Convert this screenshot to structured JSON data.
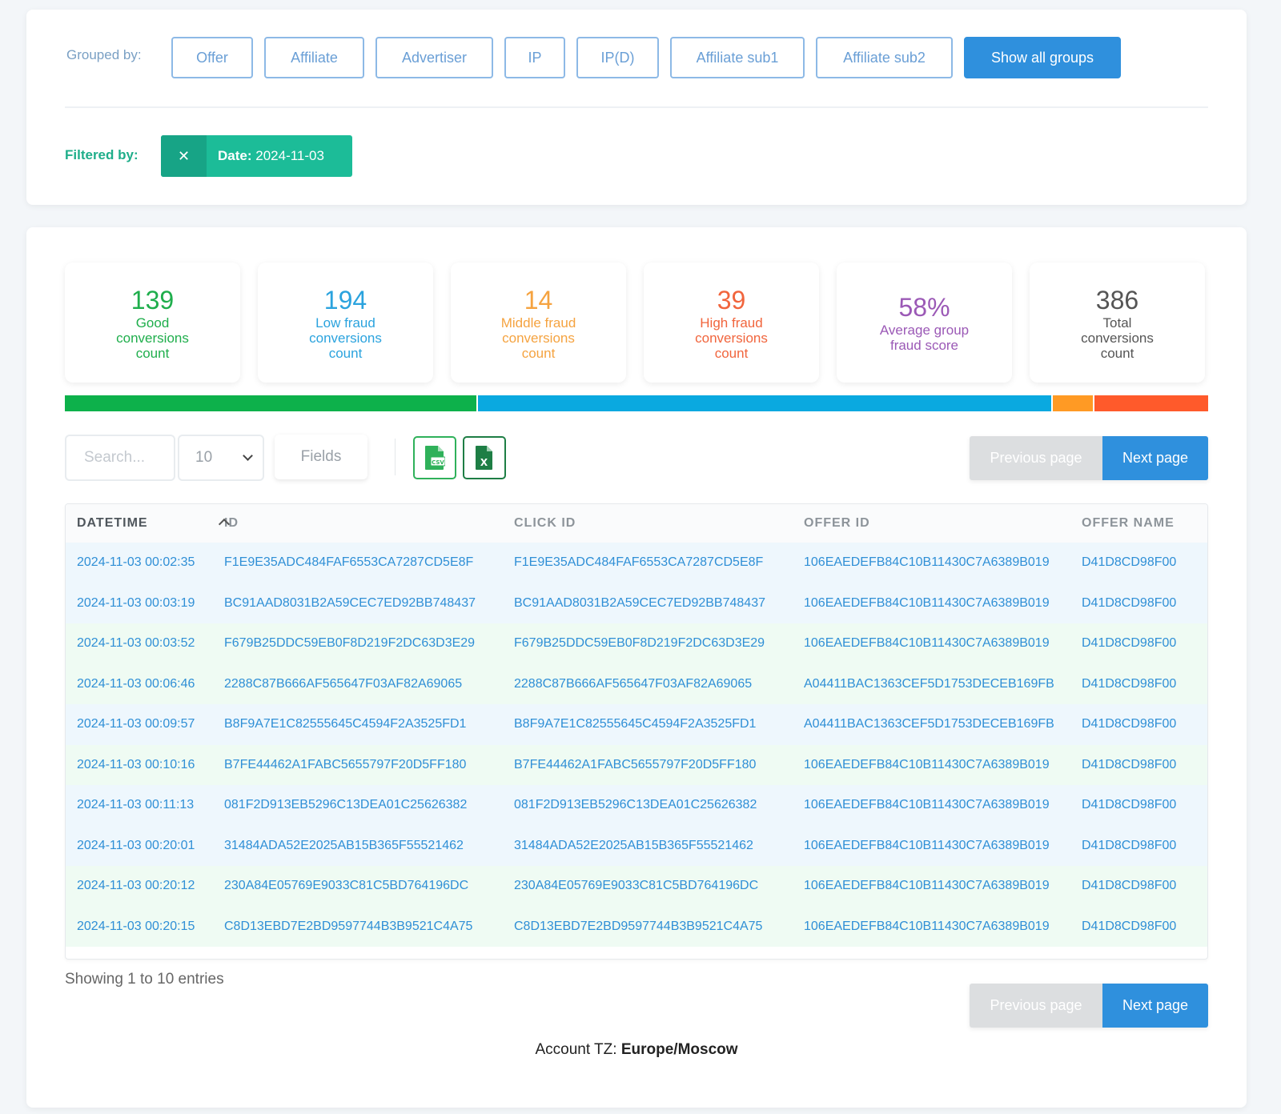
{
  "groups": {
    "label": "Grouped by:",
    "buttons": [
      "Offer",
      "Affiliate",
      "Advertiser",
      "IP",
      "IP(D)",
      "Affiliate sub1",
      "Affiliate sub2"
    ],
    "show_all": "Show all groups"
  },
  "filters": {
    "label": "Filtered by:",
    "chip_key": "Date:",
    "chip_value": "2024-11-03"
  },
  "stats": [
    {
      "value": "139",
      "label": "Good conversions count",
      "color": "#1fae4c"
    },
    {
      "value": "194",
      "label": "Low fraud conversions count",
      "color": "#2ba3de"
    },
    {
      "value": "14",
      "label": "Middle fraud conversions count",
      "color": "#f5a340"
    },
    {
      "value": "39",
      "label": "High fraud conversions count",
      "color": "#f1653d"
    },
    {
      "value": "58%",
      "label": "Average group fraud score",
      "color": "#9b59b6"
    },
    {
      "value": "386",
      "label": "Total conversions count",
      "color": "#555555"
    }
  ],
  "distribution": [
    {
      "name": "good",
      "count": 139,
      "color": "#0db14b"
    },
    {
      "name": "low",
      "count": 194,
      "color": "#0aa9e0"
    },
    {
      "name": "middle",
      "count": 14,
      "color": "#ff9a24"
    },
    {
      "name": "high",
      "count": 39,
      "color": "#ff5a2b"
    }
  ],
  "controls": {
    "search_placeholder": "Search...",
    "page_size": "10",
    "fields_label": "Fields",
    "csv_icon": "csv-file-icon",
    "xls_icon": "excel-file-icon",
    "prev_label": "Previous page",
    "next_label": "Next page"
  },
  "table": {
    "columns": [
      "DATETIME",
      "ID",
      "CLICK ID",
      "OFFER ID",
      "OFFER NAME"
    ],
    "rows": [
      {
        "tone": "blue",
        "cells": [
          "2024-11-03 00:02:35",
          "F1E9E35ADC484FAF6553CA7287CD5E8F",
          "F1E9E35ADC484FAF6553CA7287CD5E8F",
          "106EAEDEFB84C10B11430C7A6389B019",
          "D41D8CD98F00"
        ]
      },
      {
        "tone": "blue",
        "cells": [
          "2024-11-03 00:03:19",
          "BC91AAD8031B2A59CEC7ED92BB748437",
          "BC91AAD8031B2A59CEC7ED92BB748437",
          "106EAEDEFB84C10B11430C7A6389B019",
          "D41D8CD98F00"
        ]
      },
      {
        "tone": "green",
        "cells": [
          "2024-11-03 00:03:52",
          "F679B25DDC59EB0F8D219F2DC63D3E29",
          "F679B25DDC59EB0F8D219F2DC63D3E29",
          "106EAEDEFB84C10B11430C7A6389B019",
          "D41D8CD98F00"
        ]
      },
      {
        "tone": "green",
        "cells": [
          "2024-11-03 00:06:46",
          "2288C87B666AF565647F03AF82A69065",
          "2288C87B666AF565647F03AF82A69065",
          "A04411BAC1363CEF5D1753DECEB169FB",
          "D41D8CD98F00"
        ]
      },
      {
        "tone": "blue",
        "cells": [
          "2024-11-03 00:09:57",
          "B8F9A7E1C82555645C4594F2A3525FD1",
          "B8F9A7E1C82555645C4594F2A3525FD1",
          "A04411BAC1363CEF5D1753DECEB169FB",
          "D41D8CD98F00"
        ]
      },
      {
        "tone": "green",
        "cells": [
          "2024-11-03 00:10:16",
          "B7FE44462A1FABC5655797F20D5FF180",
          "B7FE44462A1FABC5655797F20D5FF180",
          "106EAEDEFB84C10B11430C7A6389B019",
          "D41D8CD98F00"
        ]
      },
      {
        "tone": "blue",
        "cells": [
          "2024-11-03 00:11:13",
          "081F2D913EB5296C13DEA01C25626382",
          "081F2D913EB5296C13DEA01C25626382",
          "106EAEDEFB84C10B11430C7A6389B019",
          "D41D8CD98F00"
        ]
      },
      {
        "tone": "blue",
        "cells": [
          "2024-11-03 00:20:01",
          "31484ADA52E2025AB15B365F55521462",
          "31484ADA52E2025AB15B365F55521462",
          "106EAEDEFB84C10B11430C7A6389B019",
          "D41D8CD98F00"
        ]
      },
      {
        "tone": "green",
        "cells": [
          "2024-11-03 00:20:12",
          "230A84E05769E9033C81C5BD764196DC",
          "230A84E05769E9033C81C5BD764196DC",
          "106EAEDEFB84C10B11430C7A6389B019",
          "D41D8CD98F00"
        ]
      },
      {
        "tone": "green",
        "cells": [
          "2024-11-03 00:20:15",
          "C8D13EBD7E2BD9597744B3B9521C4A75",
          "C8D13EBD7E2BD9597744B3B9521C4A75",
          "106EAEDEFB84C10B11430C7A6389B019",
          "D41D8CD98F00"
        ]
      }
    ]
  },
  "footer": {
    "showing": "Showing 1 to 10 entries",
    "tz_label": "Account TZ:",
    "tz_value": "Europe/Moscow"
  }
}
